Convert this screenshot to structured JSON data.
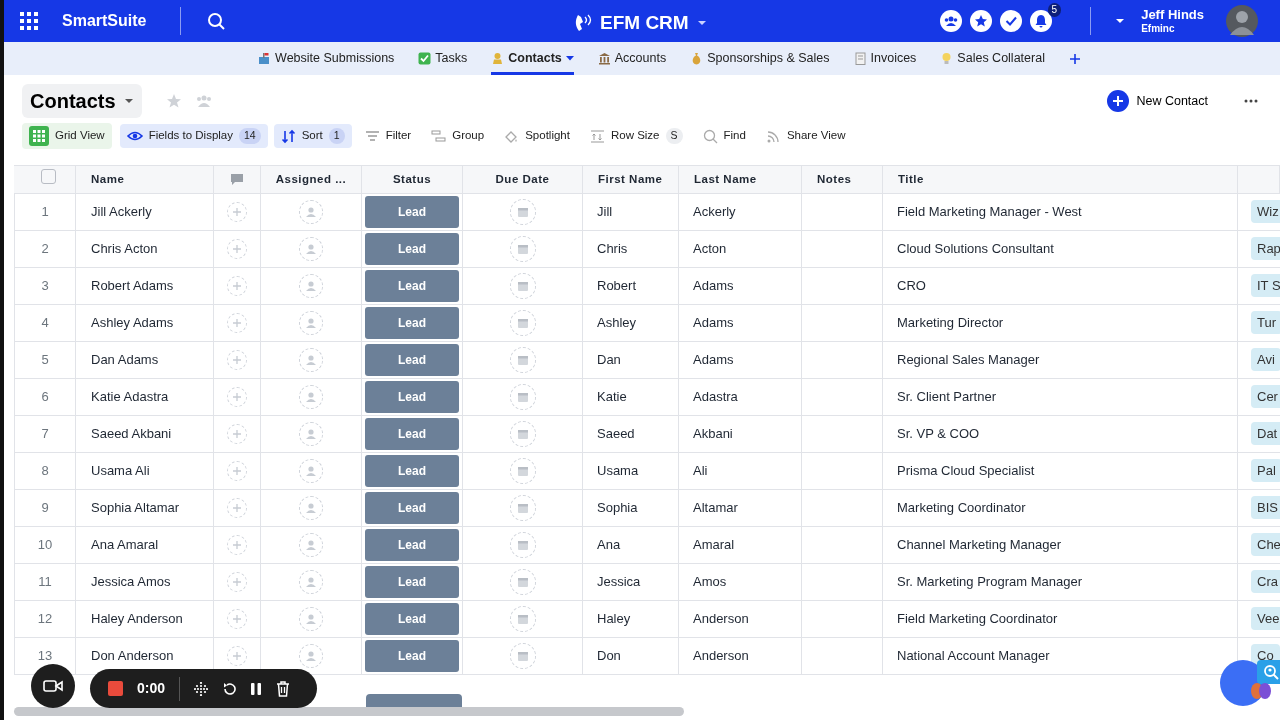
{
  "app": {
    "name": "SmartSuite"
  },
  "workspace": {
    "title": "EFM CRM"
  },
  "notifications": {
    "count": "5"
  },
  "user": {
    "name": "Jeff Hinds",
    "org": "Efminc"
  },
  "tabs": [
    {
      "label": "Website Submissions",
      "kind": "mailbox",
      "selected": false
    },
    {
      "label": "Tasks",
      "kind": "check",
      "selected": false
    },
    {
      "label": "Contacts",
      "kind": "person",
      "selected": true
    },
    {
      "label": "Accounts",
      "kind": "bank",
      "selected": false
    },
    {
      "label": "Sponsorships & Sales",
      "kind": "moneybag",
      "selected": false
    },
    {
      "label": "Invoices",
      "kind": "receipt",
      "selected": false
    },
    {
      "label": "Sales Collateral",
      "kind": "bulb",
      "selected": false
    }
  ],
  "view": {
    "title": "Contacts",
    "new_button": "New Contact"
  },
  "toolbar": [
    {
      "label": "Grid View",
      "kind": "grid"
    },
    {
      "label": "Fields to Display",
      "kind": "eye",
      "count": "14"
    },
    {
      "label": "Sort",
      "kind": "sort",
      "count": "1"
    },
    {
      "label": "Filter",
      "kind": "filter"
    },
    {
      "label": "Group",
      "kind": "group"
    },
    {
      "label": "Spotlight",
      "kind": "bucket"
    },
    {
      "label": "Row Size",
      "kind": "rowsize",
      "count": "S"
    },
    {
      "label": "Find",
      "kind": "find"
    },
    {
      "label": "Share View",
      "kind": "share"
    }
  ],
  "table": {
    "select_all": {
      "checked": false
    },
    "columns": [
      "Name",
      "Assigned ...",
      "Status",
      "Due Date",
      "First Name",
      "Last Name",
      "Notes",
      "Title"
    ],
    "rows": [
      {
        "number": "1",
        "name": "Jill Ackerly",
        "status": "Lead",
        "first_name": "Jill",
        "last_name": "Ackerly",
        "title": "Field Marketing Manager - West",
        "column_10": "Wiz"
      },
      {
        "number": "2",
        "name": "Chris Acton",
        "status": "Lead",
        "first_name": "Chris",
        "last_name": "Acton",
        "title": "Cloud Solutions Consultant",
        "column_10": "Rap"
      },
      {
        "number": "3",
        "name": "Robert Adams",
        "status": "Lead",
        "first_name": "Robert",
        "last_name": "Adams",
        "title": "CRO",
        "column_10": "IT S"
      },
      {
        "number": "4",
        "name": "Ashley Adams",
        "status": "Lead",
        "first_name": "Ashley",
        "last_name": "Adams",
        "title": "Marketing Director",
        "column_10": "Tur"
      },
      {
        "number": "5",
        "name": "Dan Adams",
        "status": "Lead",
        "first_name": "Dan",
        "last_name": "Adams",
        "title": "Regional Sales Manager",
        "column_10": "Avi"
      },
      {
        "number": "6",
        "name": "Katie Adastra",
        "status": "Lead",
        "first_name": "Katie",
        "last_name": "Adastra",
        "title": "Sr. Client Partner",
        "column_10": "Cer"
      },
      {
        "number": "7",
        "name": "Saeed Akbani",
        "status": "Lead",
        "first_name": "Saeed",
        "last_name": "Akbani",
        "title": "Sr. VP & COO",
        "column_10": "Dat"
      },
      {
        "number": "8",
        "name": "Usama Ali",
        "status": "Lead",
        "first_name": "Usama",
        "last_name": "Ali",
        "title": "Prisma Cloud Specialist",
        "column_10": "Pal"
      },
      {
        "number": "9",
        "name": "Sophia Altamar",
        "status": "Lead",
        "first_name": "Sophia",
        "last_name": "Altamar",
        "title": "Marketing Coordinator",
        "column_10": "BIS"
      },
      {
        "number": "10",
        "name": "Ana Amaral",
        "status": "Lead",
        "first_name": "Ana",
        "last_name": "Amaral",
        "title": "Channel Marketing Manager",
        "column_10": "Che"
      },
      {
        "number": "11",
        "name": "Jessica Amos",
        "status": "Lead",
        "first_name": "Jessica",
        "last_name": "Amos",
        "title": "Sr. Marketing Program Manager",
        "column_10": "Cra"
      },
      {
        "number": "12",
        "name": "Haley Anderson",
        "status": "Lead",
        "first_name": "Haley",
        "last_name": "Anderson",
        "title": "Field Marketing Coordinator",
        "column_10": "Vee"
      },
      {
        "number": "13",
        "name": "Don Anderson",
        "status": "Lead",
        "first_name": "Don",
        "last_name": "Anderson",
        "title": "National Account Manager",
        "column_10": "Co"
      }
    ]
  },
  "recorder": {
    "time": "0:00"
  }
}
